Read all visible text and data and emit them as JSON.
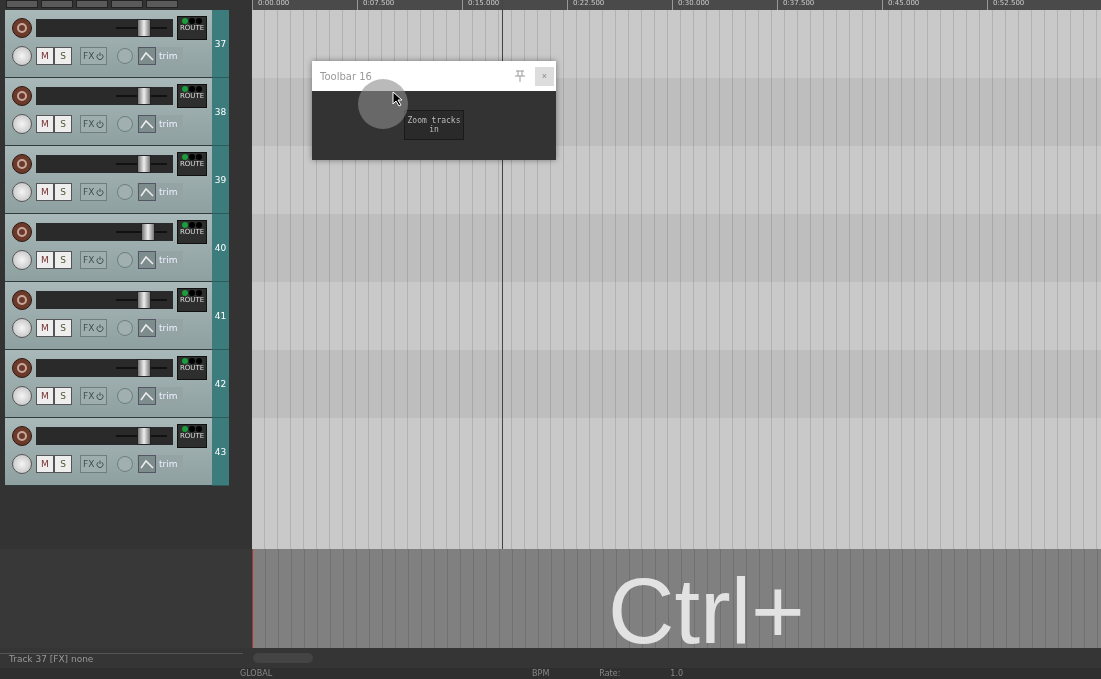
{
  "ruler": {
    "labels": [
      "0:00.000",
      "0:07.500",
      "0:15.000",
      "0:22.500",
      "0:30.000",
      "0:37.500",
      "0:45.000",
      "0:52.500"
    ]
  },
  "tracks": [
    {
      "number": "37",
      "level": 0.55,
      "mute": "M",
      "solo": "S",
      "fx": "FX",
      "trim": "trim",
      "route": "ROUTE"
    },
    {
      "number": "38",
      "level": 0.55,
      "mute": "M",
      "solo": "S",
      "fx": "FX",
      "trim": "trim",
      "route": "ROUTE"
    },
    {
      "number": "39",
      "level": 0.55,
      "mute": "M",
      "solo": "S",
      "fx": "FX",
      "trim": "trim",
      "route": "ROUTE"
    },
    {
      "number": "40",
      "level": 0.62,
      "mute": "M",
      "solo": "S",
      "fx": "FX",
      "trim": "trim",
      "route": "ROUTE"
    },
    {
      "number": "41",
      "level": 0.55,
      "mute": "M",
      "solo": "S",
      "fx": "FX",
      "trim": "trim",
      "route": "ROUTE"
    },
    {
      "number": "42",
      "level": 0.55,
      "mute": "M",
      "solo": "S",
      "fx": "FX",
      "trim": "trim",
      "route": "ROUTE"
    },
    {
      "number": "43",
      "level": 0.55,
      "mute": "M",
      "solo": "S",
      "fx": "FX",
      "trim": "trim",
      "route": "ROUTE"
    }
  ],
  "toolbar_window": {
    "title": "Toolbar 16",
    "close": "×",
    "buttons": [
      {
        "label": "Zoom tracks in"
      }
    ]
  },
  "keystroke_overlay": "Ctrl+",
  "status_bar": {
    "text": "Track 37 [FX] none"
  },
  "transport": {
    "global": "GLOBAL",
    "bpm_label": "BPM",
    "rate_label": "Rate:",
    "rate_value": "1.0"
  }
}
